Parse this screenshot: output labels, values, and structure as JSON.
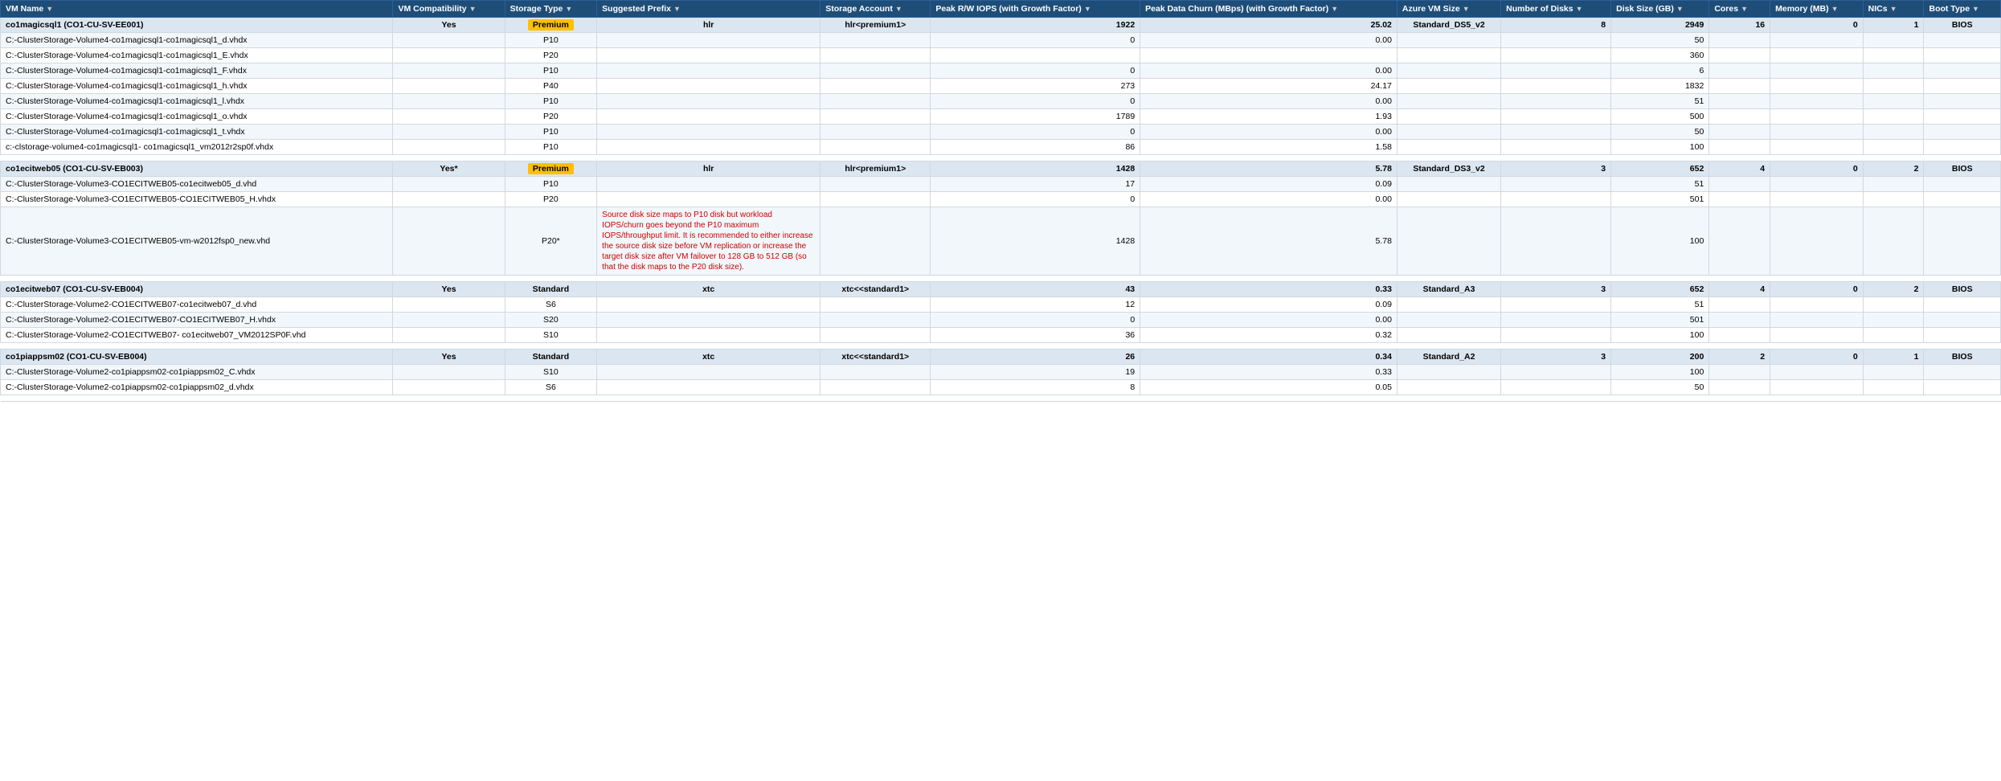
{
  "headers": [
    {
      "key": "vmname",
      "label": "VM Name",
      "sort": true
    },
    {
      "key": "compat",
      "label": "VM Compatibility",
      "sort": true
    },
    {
      "key": "storage_type",
      "label": "Storage Type",
      "sort": true
    },
    {
      "key": "prefix",
      "label": "Suggested Prefix",
      "sort": true
    },
    {
      "key": "account",
      "label": "Storage Account",
      "sort": true
    },
    {
      "key": "iops",
      "label": "Peak R/W IOPS (with Growth Factor)",
      "sort": true
    },
    {
      "key": "churn",
      "label": "Peak Data Churn (MBps) (with Growth Factor)",
      "sort": true
    },
    {
      "key": "azure_size",
      "label": "Azure VM Size",
      "sort": true
    },
    {
      "key": "num_disks",
      "label": "Number of Disks",
      "sort": true
    },
    {
      "key": "disk_size",
      "label": "Disk Size (GB)",
      "sort": true
    },
    {
      "key": "cores",
      "label": "Cores",
      "sort": true
    },
    {
      "key": "memory",
      "label": "Memory (MB)",
      "sort": true
    },
    {
      "key": "nics",
      "label": "NICs",
      "sort": true
    },
    {
      "key": "boot",
      "label": "Boot Type",
      "sort": true
    }
  ],
  "vms": [
    {
      "id": "vm1",
      "name": "co1magicsql1 (CO1-CU-SV-EE001)",
      "compat": "Yes",
      "storage_type": "Premium",
      "prefix": "hlr",
      "account": "hlr<premium1>",
      "iops": "1922",
      "churn": "25.02",
      "azure_size": "Standard_DS5_v2",
      "num_disks": "8",
      "disk_size": "2949",
      "cores": "16",
      "memory": "0",
      "nics": "1",
      "boot": "BIOS",
      "disks": [
        {
          "name": "C:-ClusterStorage-Volume4-co1magicsql1-co1magicsql1_d.vhdx",
          "storage_type": "P10",
          "iops": "0",
          "churn": "0.00",
          "disk_size": "50",
          "tooltip": ""
        },
        {
          "name": "C:-ClusterStorage-Volume4-co1magicsql1-co1magicsql1_E.vhdx",
          "storage_type": "P20",
          "iops": "",
          "churn": "",
          "disk_size": "360",
          "tooltip": ""
        },
        {
          "name": "C:-ClusterStorage-Volume4-co1magicsql1-co1magicsql1_F.vhdx",
          "storage_type": "P10",
          "iops": "0",
          "churn": "0.00",
          "disk_size": "6",
          "tooltip": ""
        },
        {
          "name": "C:-ClusterStorage-Volume4-co1magicsql1-co1magicsql1_h.vhdx",
          "storage_type": "P40",
          "iops": "273",
          "churn": "24.17",
          "disk_size": "1832",
          "tooltip": ""
        },
        {
          "name": "C:-ClusterStorage-Volume4-co1magicsql1-co1magicsql1_l.vhdx",
          "storage_type": "P10",
          "iops": "0",
          "churn": "0.00",
          "disk_size": "51",
          "tooltip": ""
        },
        {
          "name": "C:-ClusterStorage-Volume4-co1magicsql1-co1magicsql1_o.vhdx",
          "storage_type": "P20",
          "iops": "1789",
          "churn": "1.93",
          "disk_size": "500",
          "tooltip": ""
        },
        {
          "name": "C:-ClusterStorage-Volume4-co1magicsql1-co1magicsql1_t.vhdx",
          "storage_type": "P10",
          "iops": "0",
          "churn": "0.00",
          "disk_size": "50",
          "tooltip": ""
        },
        {
          "name": "c:-clstorage-volume4-co1magicsql1-\nco1magicsql1_vm2012r2sp0f.vhdx",
          "storage_type": "P10",
          "iops": "86",
          "churn": "1.58",
          "disk_size": "100",
          "tooltip": ""
        }
      ]
    },
    {
      "id": "vm2",
      "name": "co1ecitweb05 (CO1-CU-SV-EB003)",
      "compat": "Yes*",
      "storage_type": "Premium",
      "prefix": "hlr",
      "account": "hlr<premium1>",
      "iops": "1428",
      "churn": "5.78",
      "azure_size": "Standard_DS3_v2",
      "num_disks": "3",
      "disk_size": "652",
      "cores": "4",
      "memory": "0",
      "nics": "2",
      "boot": "BIOS",
      "disks": [
        {
          "name": "C:-ClusterStorage-Volume3-CO1ECITWEB05-co1ecitweb05_d.vhd",
          "storage_type": "P10",
          "iops": "17",
          "churn": "0.09",
          "disk_size": "51",
          "tooltip": ""
        },
        {
          "name": "C:-ClusterStorage-Volume3-CO1ECITWEB05-CO1ECITWEB05_H.vhdx",
          "storage_type": "P20",
          "iops": "0",
          "churn": "0.00",
          "disk_size": "501",
          "tooltip": ""
        },
        {
          "name": "C:-ClusterStorage-Volume3-CO1ECITWEB05-vm-w2012fsp0_new.vhd",
          "storage_type": "P20*",
          "iops": "1428",
          "churn": "5.78",
          "disk_size": "100",
          "tooltip": "Source disk size maps to P10 disk but workload IOPS/churn goes beyond the P10 maximum IOPS/throughput limit. It is recommended to either increase the source disk size before VM replication or increase the target disk size after VM failover to 128 GB to 512 GB (so that the disk maps to the P20 disk size)."
        }
      ]
    },
    {
      "id": "vm3",
      "name": "co1ecitweb07 (CO1-CU-SV-EB004)",
      "compat": "Yes",
      "storage_type": "Standard",
      "prefix": "xtc",
      "account": "xtc<<standard1>",
      "iops": "43",
      "churn": "0.33",
      "azure_size": "Standard_A3",
      "num_disks": "3",
      "disk_size": "652",
      "cores": "4",
      "memory": "0",
      "nics": "2",
      "boot": "BIOS",
      "disks": [
        {
          "name": "C:-ClusterStorage-Volume2-CO1ECITWEB07-co1ecitweb07_d.vhd",
          "storage_type": "S6",
          "iops": "12",
          "churn": "0.09",
          "disk_size": "51",
          "tooltip": ""
        },
        {
          "name": "C:-ClusterStorage-Volume2-CO1ECITWEB07-CO1ECITWEB07_H.vhdx",
          "storage_type": "S20",
          "iops": "0",
          "churn": "0.00",
          "disk_size": "501",
          "tooltip": ""
        },
        {
          "name": "C:-ClusterStorage-Volume2-CO1ECITWEB07-\nco1ecitweb07_VM2012SP0F.vhd",
          "storage_type": "S10",
          "iops": "36",
          "churn": "0.32",
          "disk_size": "100",
          "tooltip": ""
        }
      ]
    },
    {
      "id": "vm4",
      "name": "co1piappsm02 (CO1-CU-SV-EB004)",
      "compat": "Yes",
      "storage_type": "Standard",
      "prefix": "xtc",
      "account": "xtc<<standard1>",
      "iops": "26",
      "churn": "0.34",
      "azure_size": "Standard_A2",
      "num_disks": "3",
      "disk_size": "200",
      "cores": "2",
      "memory": "0",
      "nics": "1",
      "boot": "BIOS",
      "disks": [
        {
          "name": "C:-ClusterStorage-Volume2-co1piappsm02-co1piappsm02_C.vhdx",
          "storage_type": "S10",
          "iops": "19",
          "churn": "0.33",
          "disk_size": "100",
          "tooltip": ""
        },
        {
          "name": "C:-ClusterStorage-Volume2-co1piappsm02-co1piappsm02_d.vhdx",
          "storage_type": "S6",
          "iops": "8",
          "churn": "0.05",
          "disk_size": "50",
          "tooltip": ""
        }
      ]
    }
  ]
}
